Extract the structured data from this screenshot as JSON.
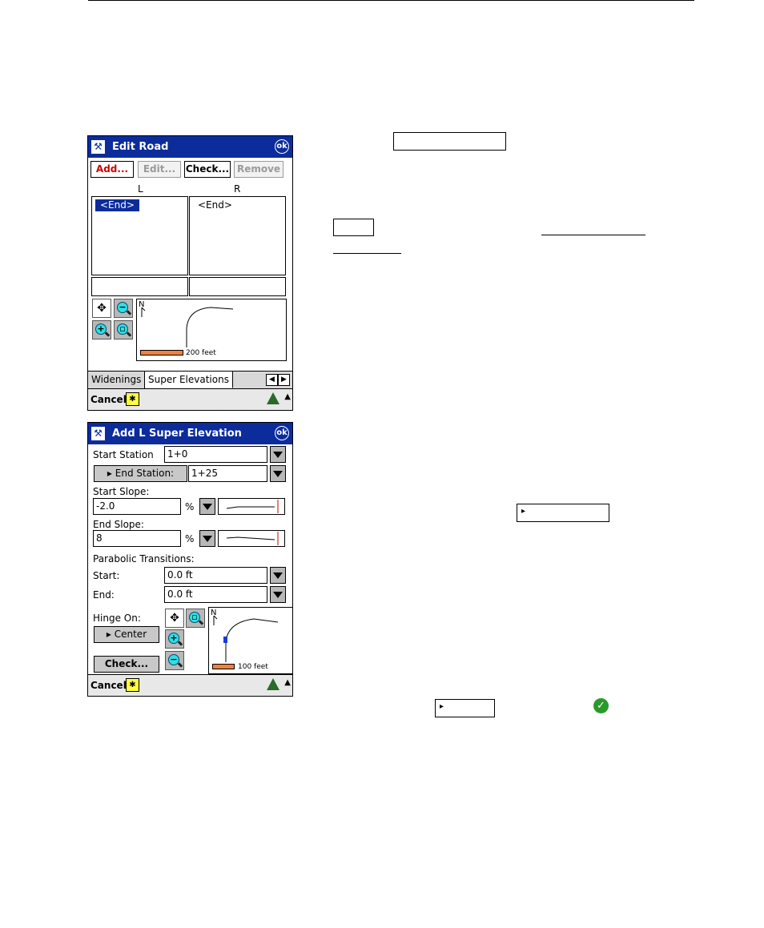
{
  "edit_road": {
    "title": "Edit Road",
    "ok": "ok",
    "buttons": {
      "add": "Add...",
      "edit": "Edit...",
      "check": "Check...",
      "remove": "Remove"
    },
    "columns": {
      "left": "L",
      "right": "R"
    },
    "left_list": [
      "<End>"
    ],
    "right_list": [
      "<End>"
    ],
    "scale": "200 feet",
    "tabs": [
      "Widenings",
      "Super Elevations"
    ],
    "cancel": "Cancel",
    "north": "N"
  },
  "add_super": {
    "title": "Add L Super Elevation",
    "ok": "ok",
    "start_station": {
      "label": "Start Station",
      "value": "1+0"
    },
    "end_station": {
      "label": "End Station:",
      "value": "1+25"
    },
    "start_slope": {
      "label": "Start Slope:",
      "value": "-2.0",
      "unit": "%"
    },
    "end_slope": {
      "label": "End Slope:",
      "value": "8",
      "unit": "%"
    },
    "parabolic": {
      "label": "Parabolic Transitions:",
      "start_label": "Start:",
      "start_value": "0.0 ft",
      "end_label": "End:",
      "end_value": "0.0 ft"
    },
    "hinge": {
      "label": "Hinge On:",
      "value": "Center"
    },
    "check": "Check...",
    "scale": "100 feet",
    "cancel": "Cancel",
    "north": "N"
  },
  "colors": {
    "title_bar": "#0c2c9c",
    "scale_bar": "#f08040",
    "tool_lens": "#2ee0e8",
    "check": "#2a9a2a"
  },
  "icons": [
    "app-logo-icon",
    "ok-icon",
    "pan-icon",
    "zoom-in-icon",
    "zoom-out-icon",
    "zoom-extents-icon",
    "star-icon",
    "survey-triangle-icon",
    "check-icon"
  ]
}
